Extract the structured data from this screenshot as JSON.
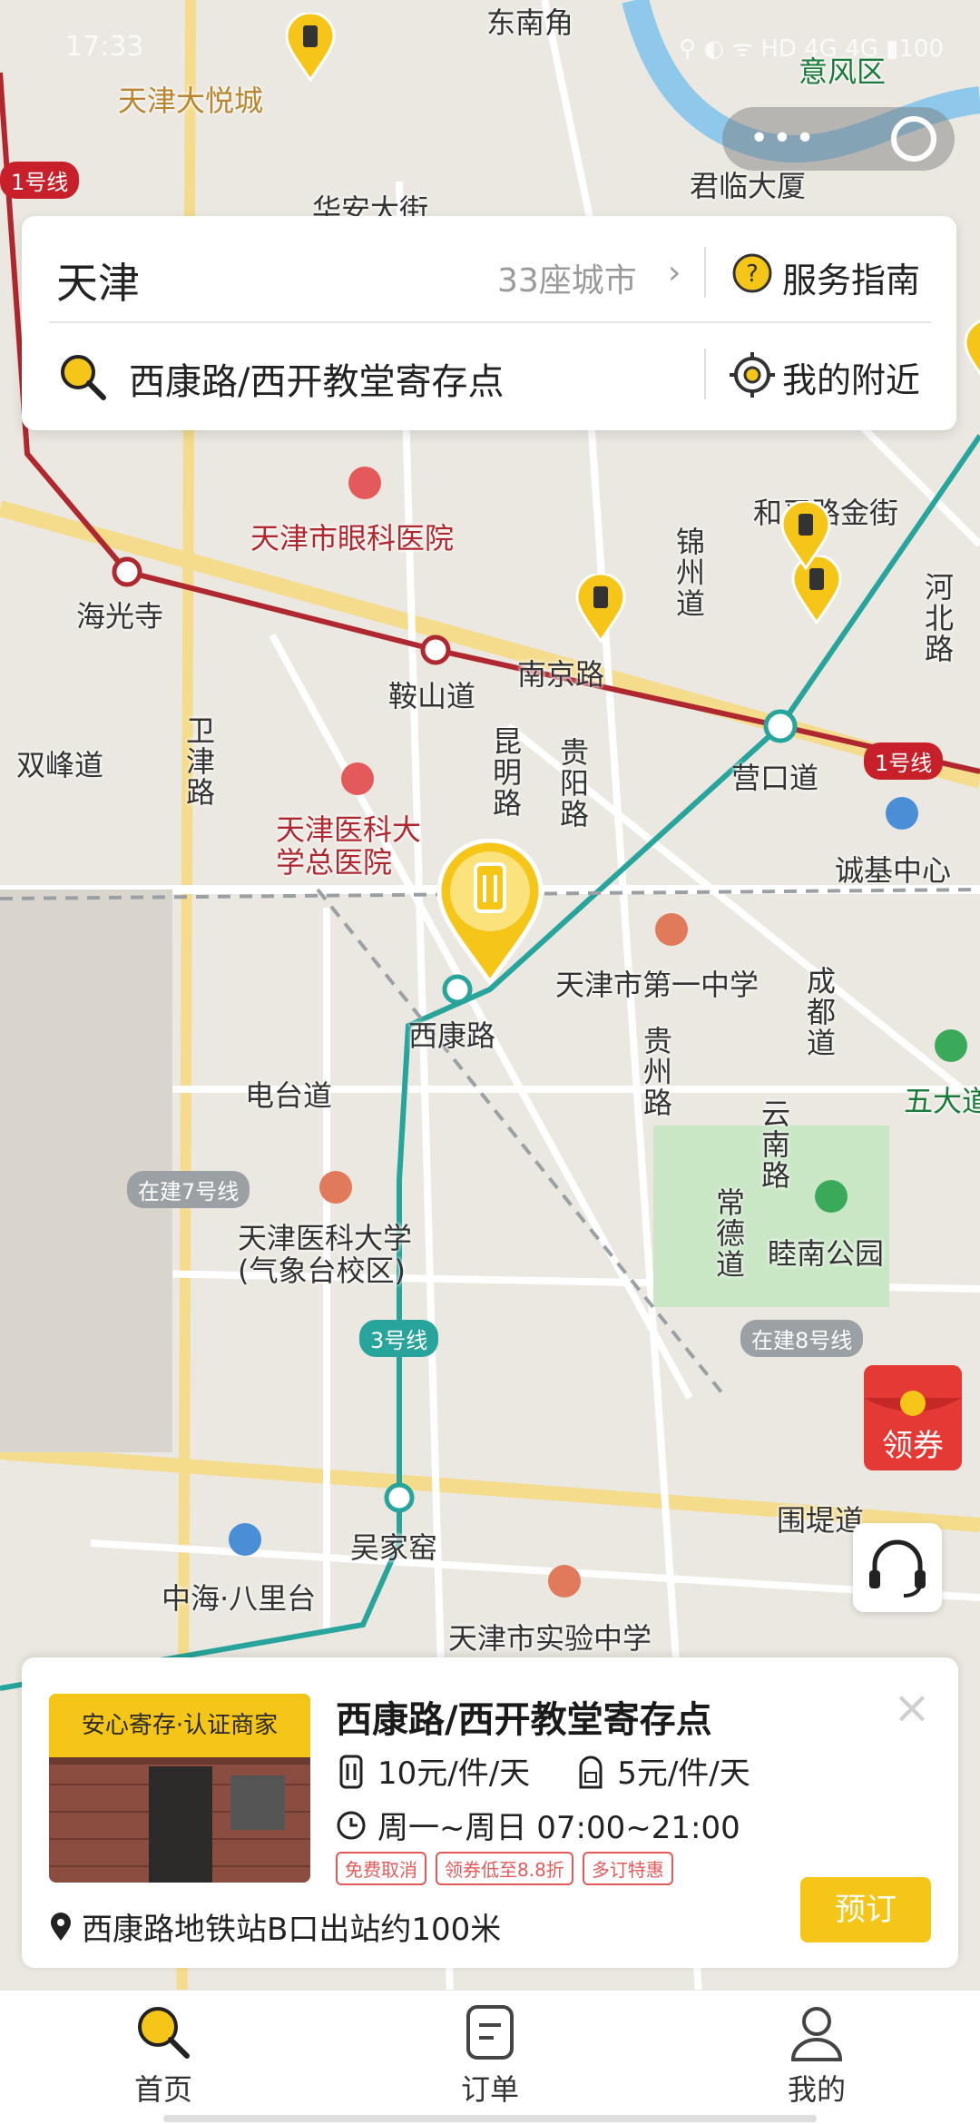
{
  "status_bar": {
    "time": "17:33",
    "icons": "⚲ ◐ ᯤ HD 4G 4G ▮100"
  },
  "map": {
    "labels": [
      {
        "text": "天津大悦城",
        "style": "gold"
      },
      {
        "text": "东南角"
      },
      {
        "text": "意风区",
        "style": "green"
      },
      {
        "text": "君临大厦"
      },
      {
        "text": "天津市眼科医院",
        "style": "red"
      },
      {
        "text": "海光寺"
      },
      {
        "text": "鞍山道"
      },
      {
        "text": "南京路"
      },
      {
        "text": "营口道"
      },
      {
        "text": "和平路金街"
      },
      {
        "text": "双峰道"
      },
      {
        "text": "诚基中心"
      },
      {
        "text": "天津医科大学总医院",
        "style": "red"
      },
      {
        "text": "西康路"
      },
      {
        "text": "天津市第一中学"
      },
      {
        "text": "五大道",
        "style": "green"
      },
      {
        "text": "电台道"
      },
      {
        "text": "天津医科大学(气象台校区)"
      },
      {
        "text": "睦南公园"
      },
      {
        "text": "吴家窑"
      },
      {
        "text": "中海·八里台"
      },
      {
        "text": "天津市实验中学"
      },
      {
        "text": "围堤道"
      }
    ],
    "vertical_labels": [
      "卫津路",
      "昆明路",
      "贵阳路",
      "锦州道",
      "贵州路",
      "成都道",
      "河北路",
      "云南路",
      "常德道",
      "华安大街"
    ],
    "line_badges": [
      "1号线",
      "1号线",
      "3号线",
      "在建7号线",
      "在建8号线"
    ]
  },
  "float_control": {
    "more": "•••"
  },
  "search": {
    "city": "天津",
    "city_count": "33座城市",
    "guide_label": "服务指南",
    "query": "西康路/西开教堂寄存点",
    "nearby_label": "我的附近"
  },
  "coupon_label": "领券",
  "store": {
    "badge": "安心寄存·认证商家",
    "name": "西康路/西开教堂寄存点",
    "price_large": "10元/件/天",
    "price_small": "5元/件/天",
    "hours": "周一~周日 07:00~21:00",
    "promos": [
      "免费取消",
      "领券低至8.8折",
      "多订特惠"
    ],
    "address": "西康路地铁站B口出站约100米",
    "book_label": "预订"
  },
  "tabs": [
    {
      "label": "首页",
      "icon": "search-icon"
    },
    {
      "label": "订单",
      "icon": "order-icon"
    },
    {
      "label": "我的",
      "icon": "profile-icon"
    }
  ],
  "colors": {
    "accent": "#f5c518",
    "metro_red": "#c8202a",
    "metro_teal": "#27a49b"
  }
}
